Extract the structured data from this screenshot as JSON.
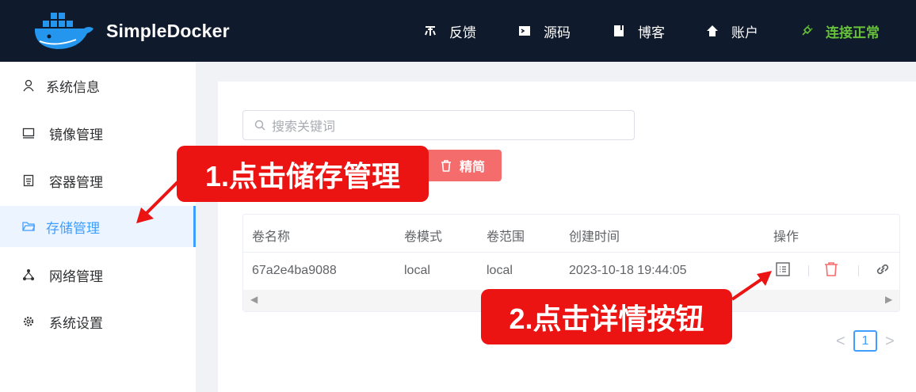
{
  "header": {
    "brand": "SimpleDocker",
    "nav": [
      {
        "label": "反馈",
        "icon": "feedback-icon"
      },
      {
        "label": "源码",
        "icon": "terminal-icon"
      },
      {
        "label": "博客",
        "icon": "book-icon"
      },
      {
        "label": "账户",
        "icon": "home-icon"
      }
    ],
    "status": {
      "label": "连接正常",
      "icon": "plug-icon",
      "color": "#67c23a"
    }
  },
  "sidebar": {
    "items": [
      {
        "label": "系统信息",
        "icon": "user-icon"
      },
      {
        "label": "镜像管理",
        "icon": "monitor-icon"
      },
      {
        "label": "容器管理",
        "icon": "container-icon"
      },
      {
        "label": "存储管理",
        "icon": "folder-icon",
        "active": true
      },
      {
        "label": "网络管理",
        "icon": "network-icon"
      },
      {
        "label": "系统设置",
        "icon": "gear-icon"
      }
    ]
  },
  "search": {
    "placeholder": "搜索关键词"
  },
  "toolbar": {
    "clean_label": "精简"
  },
  "table": {
    "headers": [
      "卷名称",
      "卷模式",
      "卷范围",
      "创建时间",
      "操作"
    ],
    "rows": [
      {
        "name": "67a2e4ba9088",
        "mode": "local",
        "scope": "local",
        "created": "2023-10-18 19:44:05"
      }
    ],
    "actions": [
      "detail-icon",
      "delete-icon",
      "link-icon"
    ]
  },
  "pagination": {
    "current": "1",
    "prev": "<",
    "next": ">"
  },
  "annotations": {
    "step1": "1.点击储存管理",
    "step2": "2.点击详情按钮"
  },
  "colors": {
    "accent": "#409eff",
    "danger": "#f56c6c",
    "header_bg": "#0f1a2c",
    "callout": "#ec1313"
  }
}
